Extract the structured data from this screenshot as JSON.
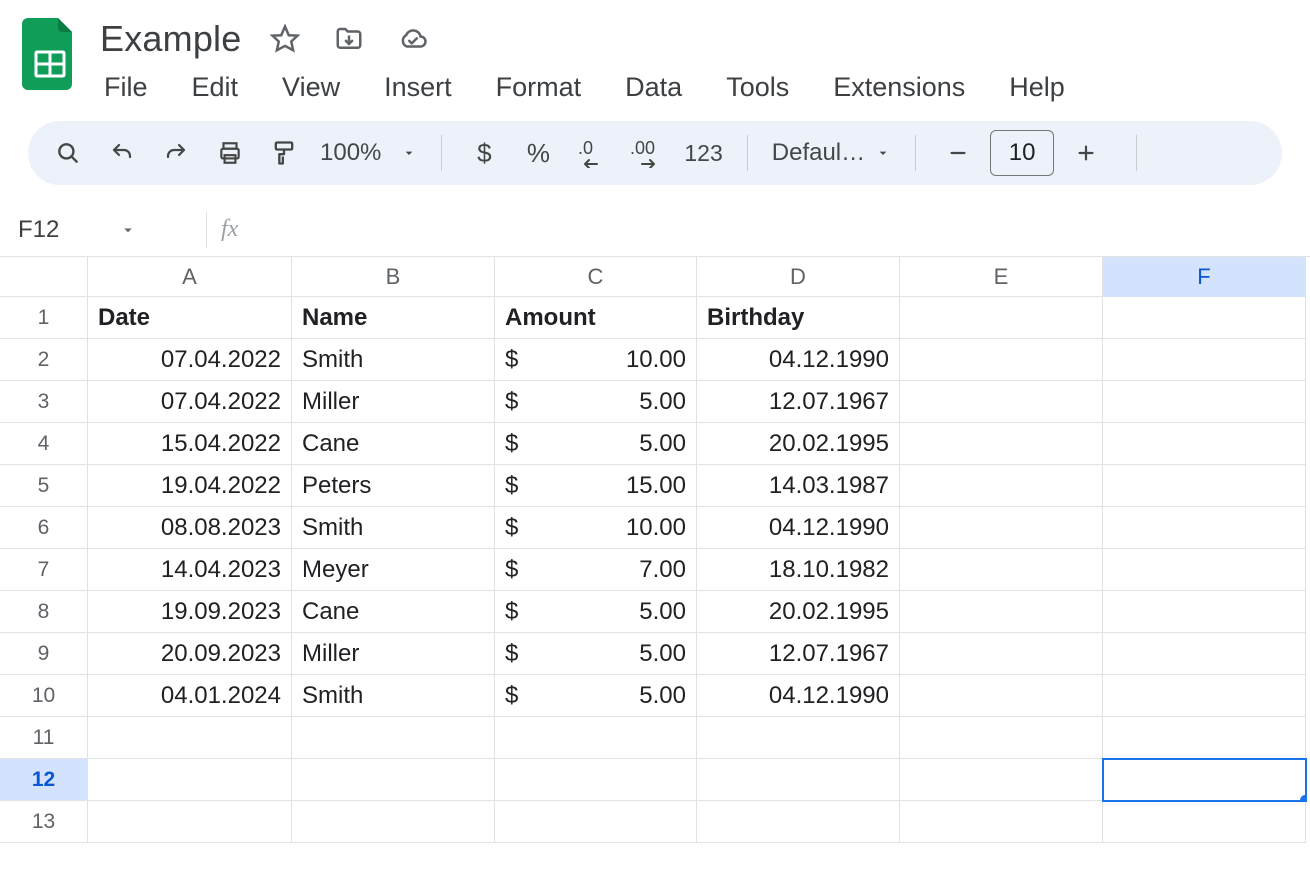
{
  "document": {
    "title": "Example"
  },
  "menu": [
    "File",
    "Edit",
    "View",
    "Insert",
    "Format",
    "Data",
    "Tools",
    "Extensions",
    "Help"
  ],
  "toolbar": {
    "zoom": "100%",
    "currency_symbol": "$",
    "percent_symbol": "%",
    "number_format_label": "123",
    "font_name": "Defaul…",
    "font_size": "10"
  },
  "name_box": "F12",
  "formula_bar": "",
  "columns": [
    "A",
    "B",
    "C",
    "D",
    "E",
    "F"
  ],
  "selected_column": "F",
  "selected_row": 12,
  "row_count": 13,
  "sheet": {
    "headers": {
      "A": "Date",
      "B": "Name",
      "C": "Amount",
      "D": "Birthday"
    },
    "rows": [
      {
        "date": "07.04.2022",
        "name": "Smith",
        "currency": "$",
        "amount": "10.00",
        "birthday": "04.12.1990"
      },
      {
        "date": "07.04.2022",
        "name": "Miller",
        "currency": "$",
        "amount": "5.00",
        "birthday": "12.07.1967"
      },
      {
        "date": "15.04.2022",
        "name": "Cane",
        "currency": "$",
        "amount": "5.00",
        "birthday": "20.02.1995"
      },
      {
        "date": "19.04.2022",
        "name": "Peters",
        "currency": "$",
        "amount": "15.00",
        "birthday": "14.03.1987"
      },
      {
        "date": "08.08.2023",
        "name": "Smith",
        "currency": "$",
        "amount": "10.00",
        "birthday": "04.12.1990"
      },
      {
        "date": "14.04.2023",
        "name": "Meyer",
        "currency": "$",
        "amount": "7.00",
        "birthday": "18.10.1982"
      },
      {
        "date": "19.09.2023",
        "name": "Cane",
        "currency": "$",
        "amount": "5.00",
        "birthday": "20.02.1995"
      },
      {
        "date": "20.09.2023",
        "name": "Miller",
        "currency": "$",
        "amount": "5.00",
        "birthday": "12.07.1967"
      },
      {
        "date": "04.01.2024",
        "name": "Smith",
        "currency": "$",
        "amount": "5.00",
        "birthday": "04.12.1990"
      }
    ]
  }
}
